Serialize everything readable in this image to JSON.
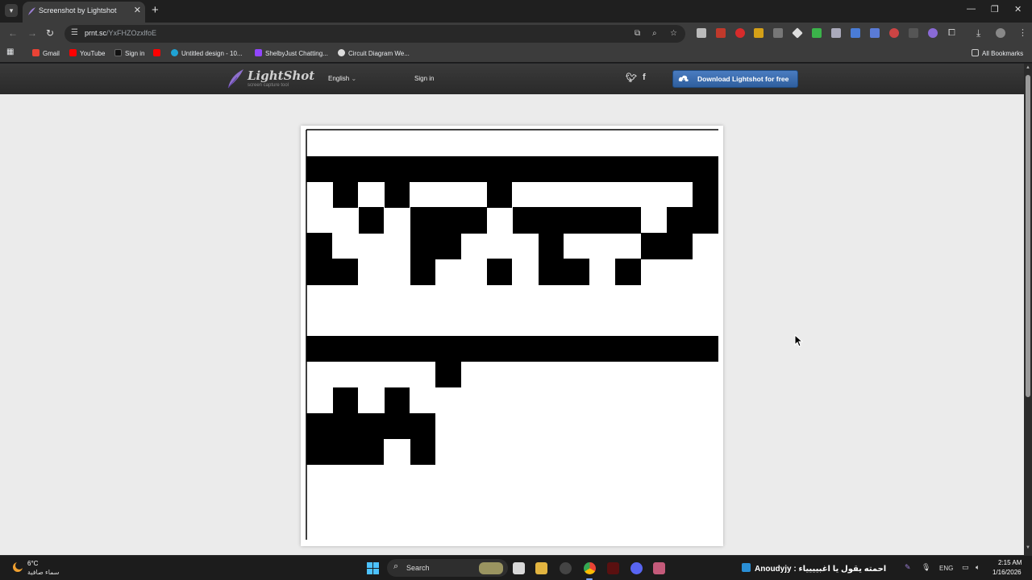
{
  "browser": {
    "tab_title": "Screenshot by Lightshot",
    "tab_menu_icon": "chevron-down-icon",
    "url_host": "prnt.sc",
    "url_path": "/YxFHZOzxlfoE",
    "bookmarks": [
      "Gmail",
      "YouTube",
      "Sign in",
      "Untitled design - 10...",
      "ShelbyJust Chatting...",
      "Circuit Diagram We..."
    ],
    "all_bookmarks": "All Bookmarks"
  },
  "lightshot": {
    "logo_text": "LightShot",
    "logo_subtitle": "screen capture tool",
    "language": "English",
    "language_caret": "⌄",
    "signin": "Sign in",
    "download_label": "Download Lightshot for free",
    "accent_color": "#3a6fb5"
  },
  "taskbar": {
    "temperature": "6°C",
    "weather_desc": "سماء صافية",
    "search_label": "Search",
    "tray_notification": "Anoudyjy : احمته يقول يا اغبيييياء",
    "language": "ENG",
    "time": "2:15 AM",
    "date": "1/16/2026"
  }
}
